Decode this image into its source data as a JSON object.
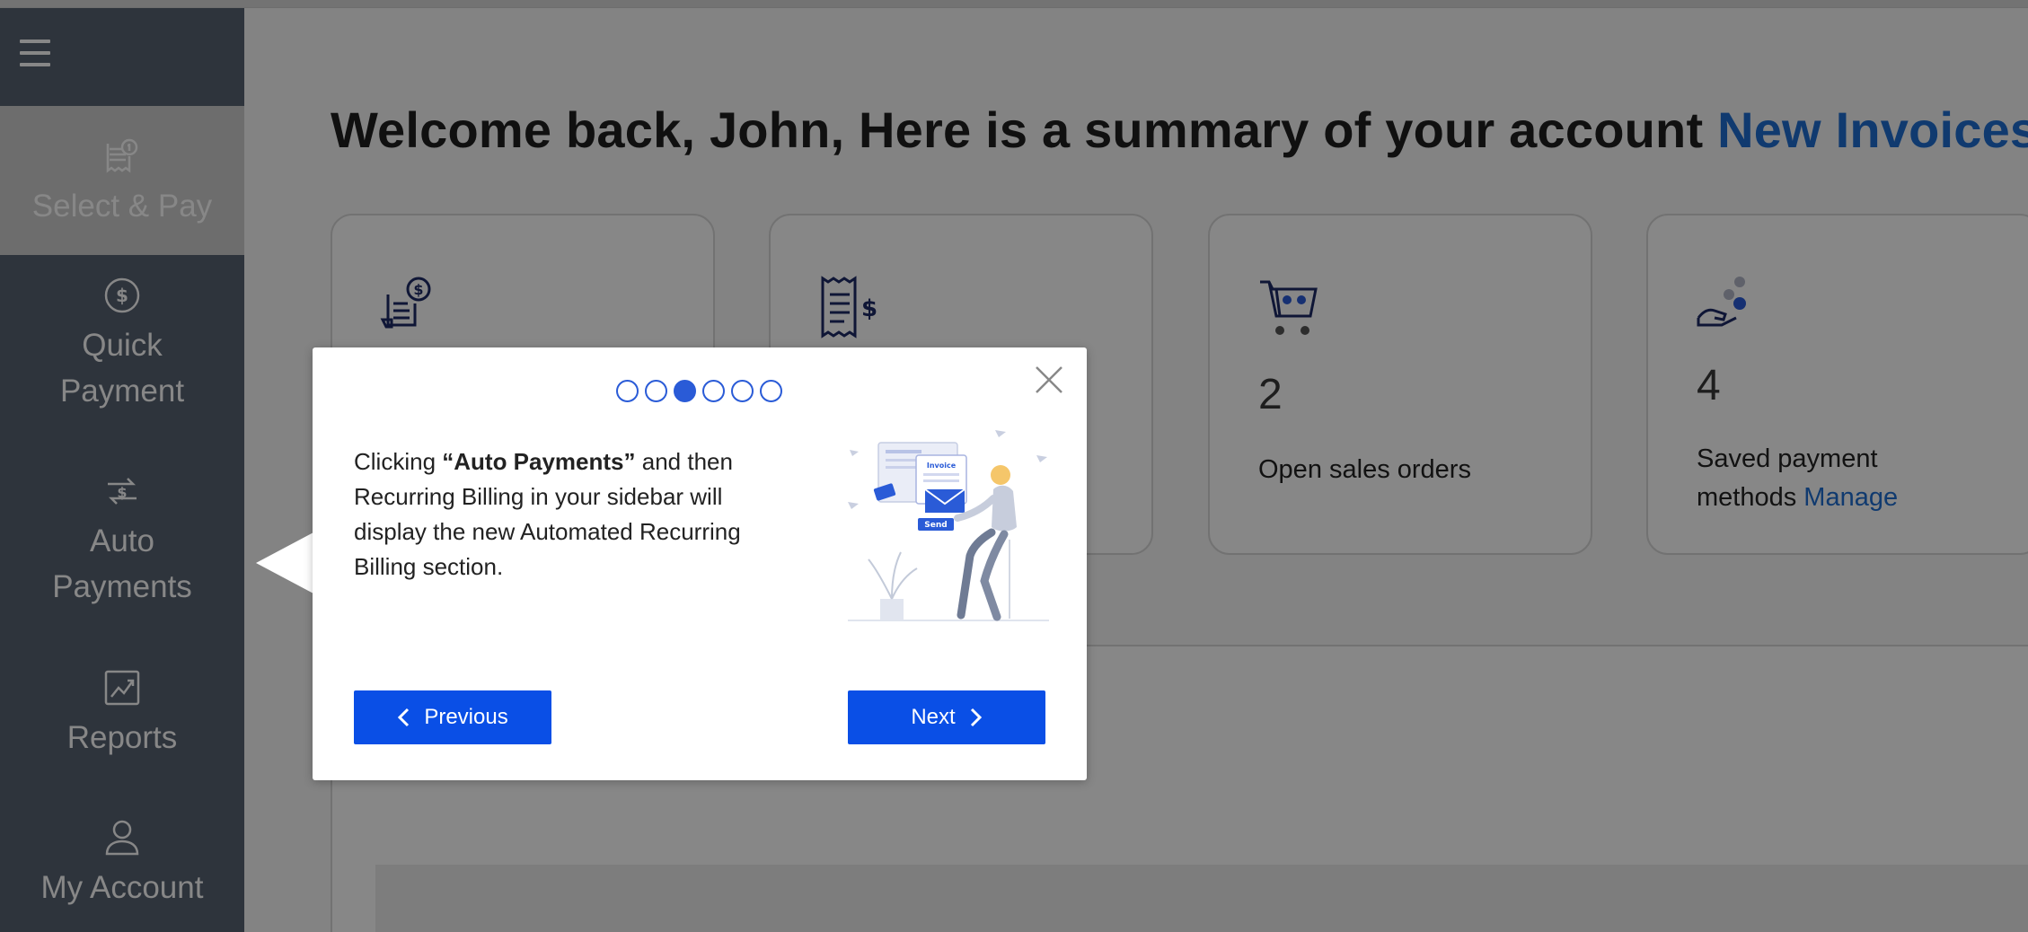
{
  "header": {
    "greeting": "Welcome back, John, Here is a summary of your account",
    "link": "New Invoices"
  },
  "sidebar": {
    "menu_icon": "hamburger-menu-icon",
    "items": [
      {
        "label": "Select & Pay",
        "icon": "invoice-dollar-icon",
        "active": true
      },
      {
        "label_line1": "Quick",
        "label_line2": "Payment",
        "icon": "dollar-circle-icon"
      },
      {
        "label_line1": "Auto",
        "label_line2": "Payments",
        "icon": "recurring-dollar-icon"
      },
      {
        "label": "Reports",
        "icon": "chart-icon"
      },
      {
        "label": "My Account",
        "icon": "user-icon"
      }
    ]
  },
  "cards": [
    {
      "icon": "invoice-dollar-icon"
    },
    {
      "icon": "receipt-dollar-icon"
    },
    {
      "icon": "cart-icon",
      "count": "2",
      "label": "Open sales orders"
    },
    {
      "icon": "hand-coins-icon",
      "count": "4",
      "label_line1": "Saved payment",
      "label_line2": "methods",
      "link": "Manage"
    }
  ],
  "tour": {
    "step_count": 6,
    "current_step": 3,
    "text_prefix": "Clicking ",
    "text_bold": "“Auto Payments”",
    "text_suffix": " and then Recurring Billing in your sidebar will display the new Automated Recurring Billing section.",
    "illustration_labels": {
      "document": "Invoice",
      "button": "Send"
    },
    "prev_label": "Previous",
    "next_label": "Next"
  },
  "colors": {
    "sidebar_bg": "#586272",
    "accent": "#0a4fe6",
    "link": "#1f6fd1",
    "icon_navy": "#1e2a66"
  }
}
